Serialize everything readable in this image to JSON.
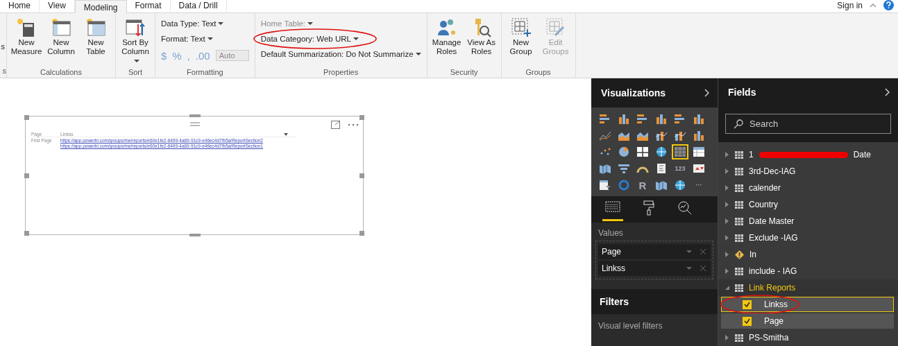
{
  "tabs": [
    {
      "label": "Home",
      "selected": false
    },
    {
      "label": "View",
      "selected": false
    },
    {
      "label": "Modeling",
      "selected": true
    },
    {
      "label": "Format",
      "selected": false
    },
    {
      "label": "Data / Drill",
      "selected": false
    }
  ],
  "sign_in": "Sign in",
  "ribbon_groups": [
    {
      "label": "s",
      "kind": "buttons",
      "buttons": [
        {
          "label": "s",
          "kind": "plain",
          "disabled": false
        }
      ]
    },
    {
      "label": "Calculations",
      "kind": "buttons",
      "buttons": [
        {
          "label": "New Measure",
          "kind": "calculator",
          "disabled": false
        },
        {
          "label": "New Column",
          "kind": "column",
          "disabled": false
        },
        {
          "label": "New Table",
          "kind": "table",
          "disabled": false
        }
      ]
    },
    {
      "label": "Sort",
      "kind": "buttons",
      "buttons": [
        {
          "label": "Sort By Column",
          "kind": "sort",
          "disabled": false,
          "dropdown": true
        }
      ]
    },
    {
      "label": "Formatting",
      "kind": "formatting",
      "lines": [
        {
          "label": "Data Type: Text",
          "disabled": false,
          "annotated": false
        },
        {
          "label": "Format: Text",
          "disabled": false,
          "annotated": false
        }
      ],
      "symbols": [
        "$",
        "%",
        ",",
        ".00"
      ],
      "auto": "Auto"
    },
    {
      "label": "Properties",
      "kind": "lines",
      "lines": [
        {
          "label": "Home Table:",
          "disabled": true,
          "annotated": false
        },
        {
          "label": "Data Category: Web URL",
          "disabled": false,
          "annotated": true
        },
        {
          "label": "Default Summarization: Do Not Summarize",
          "disabled": false,
          "annotated": false
        }
      ]
    },
    {
      "label": "Security",
      "kind": "buttons",
      "buttons": [
        {
          "label": "Manage Roles",
          "kind": "people",
          "disabled": false
        },
        {
          "label": "View As Roles",
          "kind": "key",
          "disabled": false
        }
      ]
    },
    {
      "label": "Groups",
      "kind": "buttons",
      "buttons": [
        {
          "label": "New Group",
          "kind": "newgroup",
          "disabled": false
        },
        {
          "label": "Edit Groups",
          "kind": "editgroup",
          "disabled": true
        }
      ]
    }
  ],
  "visual": {
    "columns": [
      "Page",
      "Linkss"
    ],
    "rows": [
      [
        "First Page",
        "https://app.powerbi.com/groups/me/reports/e60e1fe2-6499-4a69-91c9-e46ec4d7fb5a/ReportSection2"
      ],
      [
        "",
        "https://app.powerbi.com/groups/me/reports/e60e1fe2-6499-4a69-91c9-e46ec4d7fb5a/ReportSection1"
      ]
    ]
  },
  "visualizations": {
    "title": "Visualizations",
    "types": [
      {
        "kind": "hbar",
        "selected": false
      },
      {
        "kind": "column",
        "selected": false
      },
      {
        "kind": "hbar",
        "selected": false
      },
      {
        "kind": "column",
        "selected": false
      },
      {
        "kind": "hbar",
        "selected": false
      },
      {
        "kind": "column",
        "selected": false
      },
      {
        "kind": "line",
        "selected": false
      },
      {
        "kind": "area",
        "selected": false
      },
      {
        "kind": "area",
        "selected": false
      },
      {
        "kind": "combo",
        "selected": false
      },
      {
        "kind": "combo",
        "selected": false
      },
      {
        "kind": "column",
        "selected": false
      },
      {
        "kind": "scatter",
        "selected": false
      },
      {
        "kind": "pie",
        "selected": false
      },
      {
        "kind": "treemap",
        "selected": false
      },
      {
        "kind": "globe",
        "selected": false
      },
      {
        "kind": "table",
        "selected": true
      },
      {
        "kind": "matrix",
        "selected": false
      },
      {
        "kind": "map",
        "selected": false
      },
      {
        "kind": "funnel",
        "selected": false
      },
      {
        "kind": "gauge",
        "selected": false
      },
      {
        "kind": "card",
        "selected": false
      },
      {
        "kind": "text",
        "label": "123",
        "selected": false
      },
      {
        "kind": "kpi",
        "selected": false
      },
      {
        "kind": "slicer",
        "selected": false
      },
      {
        "kind": "donut",
        "selected": false
      },
      {
        "kind": "text",
        "label": "R",
        "selected": false
      },
      {
        "kind": "map",
        "selected": false
      },
      {
        "kind": "globe",
        "selected": false
      },
      {
        "kind": "text",
        "label": "···",
        "selected": false
      }
    ],
    "panes": [
      {
        "kind": "fields",
        "selected": true
      },
      {
        "kind": "format",
        "selected": false
      },
      {
        "kind": "analytics",
        "selected": false
      }
    ],
    "values_label": "Values",
    "values": [
      "Page",
      "Linkss"
    ],
    "filters_title": "Filters",
    "filters_label": "Visual level filters"
  },
  "fields": {
    "title": "Fields",
    "search_placeholder": "Search",
    "tables": [
      {
        "name": "1",
        "name_end": "Date",
        "redacted": true,
        "kind": "table",
        "expanded": false
      },
      {
        "name": "3rd-Dec-IAG",
        "kind": "table",
        "expanded": false
      },
      {
        "name": "calender",
        "kind": "table",
        "expanded": false
      },
      {
        "name": "Country",
        "kind": "table",
        "expanded": false
      },
      {
        "name": "Date Master",
        "kind": "table",
        "expanded": false
      },
      {
        "name": "Exclude -IAG",
        "kind": "table",
        "expanded": false
      },
      {
        "name": "In",
        "kind": "warning",
        "expanded": false
      },
      {
        "name": "include - IAG",
        "kind": "table",
        "expanded": false
      },
      {
        "name": "Link Reports",
        "kind": "table",
        "expanded": true,
        "children": [
          {
            "name": "Linkss",
            "checked": true,
            "selected": true,
            "annotated": true
          },
          {
            "name": "Page",
            "checked": true,
            "selected": false,
            "annotated": false
          }
        ]
      },
      {
        "name": "PS-Smitha",
        "kind": "table",
        "expanded": false
      }
    ]
  }
}
